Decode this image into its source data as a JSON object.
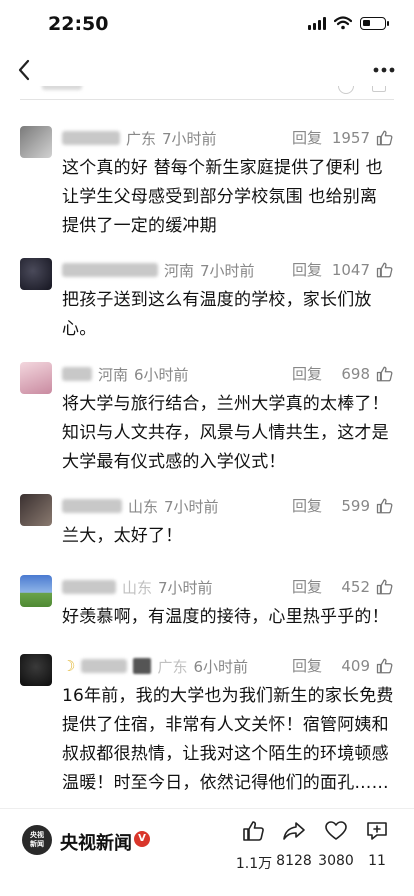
{
  "status_bar": {
    "time": "22:50",
    "battery_level": 0.35
  },
  "nav": {
    "back_icon": "chevron-left-icon",
    "more_icon": "more-dots-icon"
  },
  "comments": [
    {
      "location": "广东",
      "time": "7小时前",
      "reply": "回复",
      "likes": "1957",
      "text": [
        "这个真的好 替每个新生家庭提供了便利 也",
        "让学生父母感受到部分学校氛围 也给别离",
        "提供了一定的缓冲期"
      ]
    },
    {
      "location": "河南",
      "time": "7小时前",
      "reply": "回复",
      "likes": "1047",
      "text": [
        "把孩子送到这么有温度的学校，家长们放",
        "心。"
      ]
    },
    {
      "location": "河南",
      "time": "6小时前",
      "reply": "回复",
      "likes": "698",
      "text": [
        "将大学与旅行结合，兰州大学真的太棒了！",
        "知识与人文共存，风景与人情共生，这才是",
        "大学最有仪式感的入学仪式！"
      ]
    },
    {
      "location": "山东",
      "time": "7小时前",
      "reply": "回复",
      "likes": "599",
      "text": [
        "兰大，太好了！"
      ]
    },
    {
      "location": "山东",
      "time": "7小时前",
      "reply": "回复",
      "likes": "452",
      "text": [
        "好羡慕啊，有温度的接待，心里热乎乎的！"
      ]
    },
    {
      "location": "广东",
      "time": "6小时前",
      "reply": "回复",
      "likes": "409",
      "text": [
        "16年前，我的大学也为我们新生的家长免费",
        "提供了住宿，非常有人文关怀！宿管阿姨和",
        "叔叔都很热情，让我对这个陌生的环境顿感",
        "温暖！时至今日，依然记得他们的面孔……"
      ]
    }
  ],
  "bottom_bar": {
    "logo_text_1": "央视",
    "logo_text_2": "新闻",
    "publisher": "央视新闻",
    "verified_mark": "V",
    "actions": [
      {
        "icon": "thumbs-up-icon",
        "count": "1.1万"
      },
      {
        "icon": "share-icon",
        "count": "8128"
      },
      {
        "icon": "heart-icon",
        "count": "3080"
      },
      {
        "icon": "comment-plus-icon",
        "count": "11"
      }
    ]
  }
}
